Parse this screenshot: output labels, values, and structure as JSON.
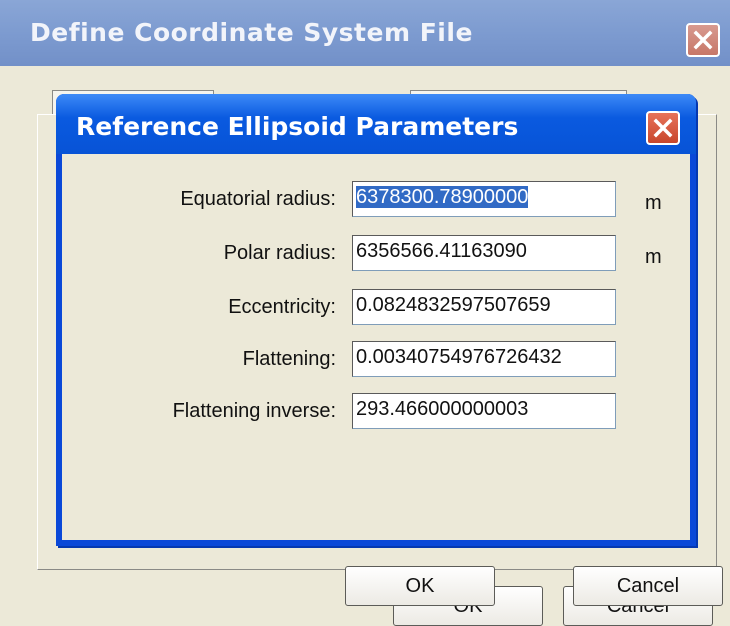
{
  "parent_window": {
    "title": "Define Coordinate System File",
    "ok_label": "OK",
    "cancel_label": "Cancel"
  },
  "dialog": {
    "title": "Reference Ellipsoid Parameters",
    "fields": [
      {
        "label": "Equatorial radius:",
        "value": "6378300.78900000",
        "unit": "m",
        "selected": true
      },
      {
        "label": "Polar radius:",
        "value": "6356566.41163090",
        "unit": "m"
      },
      {
        "label": "Eccentricity:",
        "value": "0.0824832597507659",
        "unit": ""
      },
      {
        "label": "Flattening:",
        "value": "0.00340754976726432",
        "unit": ""
      },
      {
        "label": "Flattening inverse:",
        "value": "293.466000000003",
        "unit": ""
      }
    ],
    "ok_label": "OK",
    "cancel_label": "Cancel"
  },
  "icons": {
    "close": "close-icon"
  }
}
